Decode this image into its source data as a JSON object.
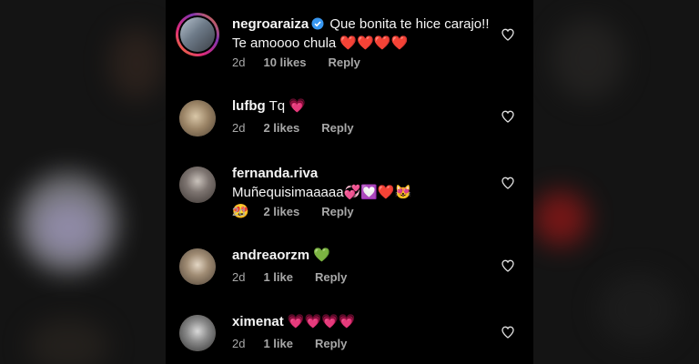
{
  "comments": [
    {
      "username": "negroaraiza",
      "verified": true,
      "text": "Que bonita te hice carajo!! Te amoooo chula ❤️❤️❤️❤️",
      "time": "2d",
      "likes": "10 likes",
      "reply": "Reply"
    },
    {
      "username": "lufbg",
      "verified": false,
      "text": "Tq 💗",
      "time": "2d",
      "likes": "2 likes",
      "reply": "Reply"
    },
    {
      "username": "fernanda.riva",
      "verified": false,
      "text": "Muñequisimaaaaa💞💟❤️😻😍",
      "time": "2d",
      "likes": "2 likes",
      "reply": "Reply"
    },
    {
      "username": "andreaorzm",
      "verified": false,
      "text": "💚",
      "time": "2d",
      "likes": "1 like",
      "reply": "Reply"
    },
    {
      "username": "ximenat",
      "verified": false,
      "text": "💗💗💗💗",
      "time": "2d",
      "likes": "1 like",
      "reply": "Reply"
    }
  ],
  "icons": {
    "like": "heart-outline-icon",
    "verified": "verified-badge-icon"
  },
  "colors": {
    "background": "#000000",
    "text": "#f5f5f5",
    "meta": "#a8a8a8",
    "verified": "#3897f0"
  }
}
